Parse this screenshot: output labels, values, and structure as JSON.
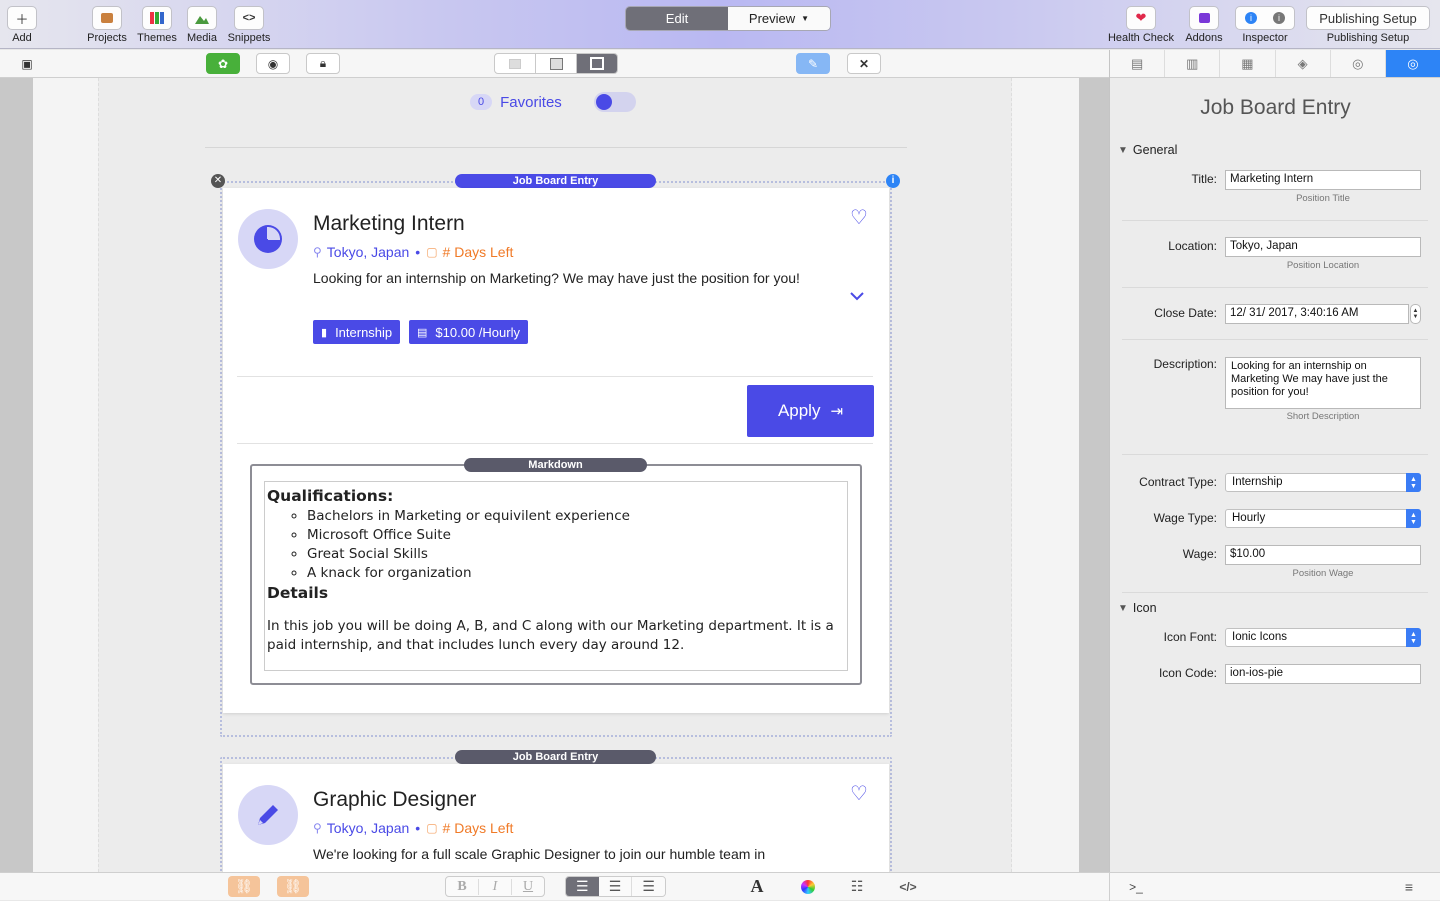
{
  "toolbar": {
    "add": "Add",
    "projects": "Projects",
    "themes": "Themes",
    "media": "Media",
    "snippets": "Snippets",
    "edit": "Edit",
    "preview": "Preview",
    "health_check": "Health Check",
    "addons": "Addons",
    "inspector": "Inspector",
    "publishing_setup_button": "Publishing Setup",
    "publishing_setup": "Publishing Setup"
  },
  "favorites": {
    "count": "0",
    "label": "Favorites"
  },
  "entries": [
    {
      "tag": "Job Board Entry",
      "title": "Marketing Intern",
      "location": "Tokyo, Japan",
      "separator": "•",
      "days_left": "# Days Left",
      "description": "Looking for an internship on Marketing? We may have just the position for you!",
      "contract_badge": "Internship",
      "wage_badge": "$10.00 /Hourly",
      "apply": "Apply",
      "markdown": {
        "tag": "Markdown",
        "qual_heading": "Qualifications:",
        "qualifications": [
          "Bachelors in Marketing or equivilent experience",
          "Microsoft Office Suite",
          "Great Social Skills",
          "A knack for organization"
        ],
        "details_heading": "Details",
        "details": "In this job you will be doing A, B, and C along with our Marketing department. It is a paid internship, and that includes lunch every day around 12."
      }
    },
    {
      "tag": "Job Board Entry",
      "title": "Graphic Designer",
      "location": "Tokyo, Japan",
      "separator": "•",
      "days_left": "# Days Left",
      "description": "We're looking for a full scale Graphic Designer to join our humble team in"
    }
  ],
  "inspector": {
    "heading": "Job Board Entry",
    "general": "General",
    "title_label": "Title:",
    "title_value": "Marketing Intern",
    "title_hint": "Position Title",
    "location_label": "Location:",
    "location_value": "Tokyo, Japan",
    "location_hint": "Position Location",
    "close_label": "Close Date:",
    "close_value": "12/ 31/ 2017,  3:40:16 AM",
    "desc_label": "Description:",
    "desc_value": "Looking for an internship on Marketing We may have just the position for you!",
    "desc_hint": "Short Description",
    "contract_label": "Contract Type:",
    "contract_value": "Internship",
    "wagetype_label": "Wage Type:",
    "wagetype_value": "Hourly",
    "wage_label": "Wage:",
    "wage_value": "$10.00",
    "wage_hint": "Position Wage",
    "icon_section": "Icon",
    "iconfont_label": "Icon Font:",
    "iconfont_value": "Ionic Icons",
    "iconcode_label": "Icon Code:",
    "iconcode_value": "ion-ios-pie"
  },
  "colors": {
    "accent": "#4a4ae6",
    "orange": "#f07a27",
    "tab_active": "#2d84f6"
  },
  "bottombar": {
    "bold": "B",
    "italic": "I",
    "underline": "U",
    "font": "A",
    "terminal": ">_"
  }
}
